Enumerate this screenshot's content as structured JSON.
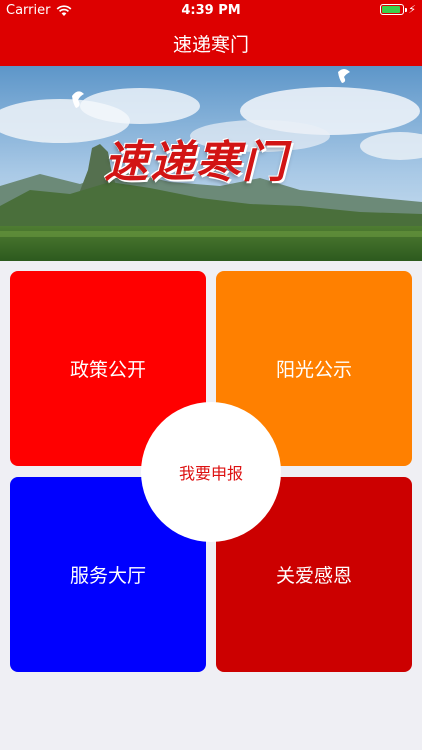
{
  "status_bar": {
    "carrier": "Carrier",
    "time": "4:39 PM",
    "battery_level": 0.9,
    "battery_color": "#3ad14a"
  },
  "nav": {
    "title": "速递寒门",
    "background_color": "#dd0000"
  },
  "banner": {
    "text": "速递寒门",
    "text_color": "#d21414"
  },
  "tiles": [
    {
      "label": "政策公开",
      "color": "#ff0000"
    },
    {
      "label": "阳光公示",
      "color": "#ff8000"
    },
    {
      "label": "服务大厅",
      "color": "#0000ff"
    },
    {
      "label": "关爱感恩",
      "color": "#cc0000"
    }
  ],
  "center_button": {
    "label": "我要申报",
    "text_color": "#dd1111"
  },
  "icons": [
    "wifi-icon",
    "battery-icon",
    "charging-bolt-icon",
    "dove-icon"
  ]
}
